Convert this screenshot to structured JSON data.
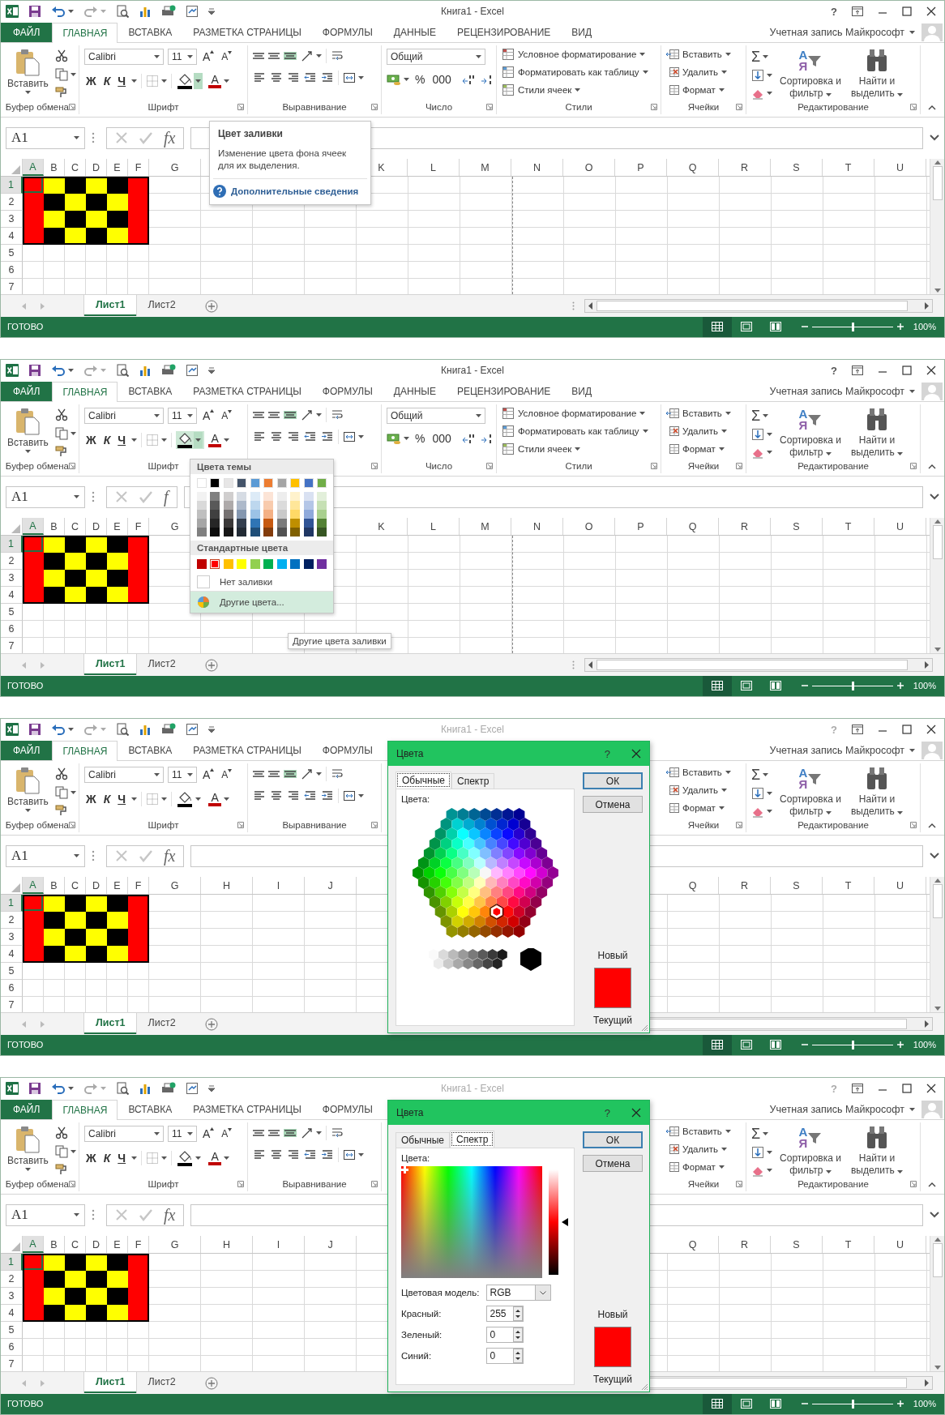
{
  "panels": [
    {
      "title_bar": {
        "title": "Книга1 - Excel",
        "active": true,
        "help": "?"
      },
      "ribbon_tabs": [
        {
          "label": "ФАЙЛ",
          "kind": "file",
          "selected": false
        },
        {
          "label": "ГЛАВНАЯ",
          "kind": "tab",
          "selected": true
        },
        {
          "label": "ВСТАВКА",
          "kind": "tab",
          "selected": false
        },
        {
          "label": "РАЗМЕТКА СТРАНИЦЫ",
          "kind": "tab",
          "selected": false
        },
        {
          "label": "ФОРМУЛЫ",
          "kind": "tab",
          "selected": false
        },
        {
          "label": "ДАННЫЕ",
          "kind": "tab",
          "selected": false
        },
        {
          "label": "РЕЦЕНЗИРОВАНИЕ",
          "kind": "tab",
          "selected": false
        },
        {
          "label": "ВИД",
          "kind": "tab",
          "selected": false
        }
      ],
      "account": "Учетная запись Майкрософт",
      "ribbon_groups": [
        {
          "kind": "clipboard",
          "label": "Буфер обмена",
          "paste": "Вставить"
        },
        {
          "kind": "font",
          "label": "Шрифт",
          "font": "Calibri",
          "size": "11",
          "grow": "A",
          "shrink": "A",
          "bold": "Ж",
          "italic": "К",
          "underline": "Ч",
          "font_color": "A",
          "fill_button_highlighted": false,
          "fill_caret_highlighted": true
        },
        {
          "kind": "alignment",
          "label": "Выравнивание",
          "bottom_align_on": true
        },
        {
          "kind": "number",
          "label": "Число",
          "format": "Общий",
          "percent": "%",
          "thousands": "000"
        },
        {
          "kind": "styles",
          "label": "Стили",
          "items": [
            "Условное форматирование",
            "Форматировать как таблицу",
            "Стили ячеек"
          ]
        },
        {
          "kind": "cells",
          "label": "Ячейки",
          "items": [
            "Вставить",
            "Удалить",
            "Формат"
          ]
        },
        {
          "kind": "editing",
          "label": "Редактирование",
          "autosum": "Σ",
          "sort_letters": [
            "A",
            "Я"
          ],
          "sort": "Сортировка и фильтр",
          "find": "Найти и выделить"
        }
      ],
      "formula_bar": {
        "name_box": "A1",
        "fx": "fx"
      },
      "grid": {
        "column_headers": [
          "A",
          "B",
          "C",
          "D",
          "E",
          "F",
          "G"
        ],
        "column_headers_right": [
          "K",
          "L",
          "M",
          "N",
          "O",
          "P",
          "Q",
          "R",
          "S",
          "T",
          "U"
        ],
        "rows": [
          {
            "header": "1",
            "cells": [
              {
                "color": "#ff0000",
                "selected": true
              },
              {
                "color": "#ffff00",
                "selected": false
              },
              {
                "color": "#000000",
                "selected": false
              },
              {
                "color": "#ffff00",
                "selected": false
              },
              {
                "color": "#000000",
                "selected": false
              },
              {
                "color": "#ff0000",
                "selected": false
              }
            ]
          },
          {
            "header": "2",
            "cells": [
              {
                "color": "#ff0000",
                "selected": false
              },
              {
                "color": "#000000",
                "selected": false
              },
              {
                "color": "#ffff00",
                "selected": false
              },
              {
                "color": "#000000",
                "selected": false
              },
              {
                "color": "#ffff00",
                "selected": false
              },
              {
                "color": "#ff0000",
                "selected": false
              }
            ]
          },
          {
            "header": "3",
            "cells": [
              {
                "color": "#ff0000",
                "selected": false
              },
              {
                "color": "#ffff00",
                "selected": false
              },
              {
                "color": "#000000",
                "selected": false
              },
              {
                "color": "#ffff00",
                "selected": false
              },
              {
                "color": "#000000",
                "selected": false
              },
              {
                "color": "#ff0000",
                "selected": false
              }
            ]
          },
          {
            "header": "4",
            "cells": [
              {
                "color": "#ff0000",
                "selected": false
              },
              {
                "color": "#000000",
                "selected": false
              },
              {
                "color": "#ffff00",
                "selected": false
              },
              {
                "color": "#000000",
                "selected": false
              },
              {
                "color": "#ffff00",
                "selected": false
              },
              {
                "color": "#ff0000",
                "selected": false
              }
            ]
          },
          {
            "header": "5"
          },
          {
            "header": "6"
          },
          {
            "header": "7"
          }
        ]
      },
      "sheet_tabs": [
        {
          "label": "Лист1",
          "selected": true
        },
        {
          "label": "Лист2",
          "selected": false
        }
      ],
      "status_bar": {
        "text": "ГОТОВО",
        "views": [
          {
            "kind": "normal",
            "selected": true
          },
          {
            "kind": "page_layout",
            "selected": false
          },
          {
            "kind": "page_break",
            "selected": false
          }
        ],
        "zoom_slider": {
          "level": 0.5
        },
        "zoom": "100%"
      },
      "tooltip": {
        "title": "Цвет заливки",
        "text": "Изменение цвета фона ячеек для их выделения.",
        "link": "Дополнительные сведения"
      }
    },
    {
      "title_bar": {
        "title": "Книга1 - Excel",
        "active": true,
        "help": "?"
      },
      "ribbon_tabs": [
        {
          "label": "ФАЙЛ",
          "kind": "file",
          "selected": false
        },
        {
          "label": "ГЛАВНАЯ",
          "kind": "tab",
          "selected": true
        },
        {
          "label": "ВСТАВКА",
          "kind": "tab",
          "selected": false
        },
        {
          "label": "РАЗМЕТКА СТРАНИЦЫ",
          "kind": "tab",
          "selected": false
        },
        {
          "label": "ФОРМУЛЫ",
          "kind": "tab",
          "selected": false
        },
        {
          "label": "ДАННЫЕ",
          "kind": "tab",
          "selected": false
        },
        {
          "label": "РЕЦЕНЗИРОВАНИЕ",
          "kind": "tab",
          "selected": false
        },
        {
          "label": "ВИД",
          "kind": "tab",
          "selected": false
        }
      ],
      "account": "Учетная запись Майкрософт",
      "ribbon_groups": [
        {
          "kind": "clipboard",
          "label": "Буфер обмена",
          "paste": "Вставить"
        },
        {
          "kind": "font",
          "label": "Шрифт",
          "font": "Calibri",
          "size": "11",
          "grow": "A",
          "shrink": "A",
          "bold": "Ж",
          "italic": "К",
          "underline": "Ч",
          "font_color": "A",
          "fill_button_highlighted": true,
          "fill_caret_highlighted": true
        },
        {
          "kind": "alignment",
          "bottom_align_on": true
        },
        {
          "kind": "number",
          "label": "Число",
          "format": "Общий",
          "percent": "%",
          "thousands": "000"
        },
        {
          "kind": "styles",
          "label": "Стили",
          "items": [
            "Условное форматирование",
            "Форматировать как таблицу",
            "Стили ячеек"
          ]
        },
        {
          "kind": "cells",
          "label": "Ячейки",
          "items": [
            "Вставить",
            "Удалить",
            "Формат"
          ]
        },
        {
          "kind": "editing",
          "label": "Редактирование",
          "autosum": "Σ",
          "sort_letters": [
            "A",
            "Я"
          ],
          "sort": "Сортировка и фильтр",
          "find": "Найти и выделить"
        }
      ],
      "formula_bar": {
        "name_box": "A1",
        "fx": "f"
      },
      "grid": {
        "column_headers": [
          "A",
          "B",
          "C",
          "D",
          "E",
          "F",
          "G"
        ],
        "column_headers_right": [
          "K",
          "L",
          "M",
          "N",
          "O",
          "P",
          "Q",
          "R",
          "S",
          "T",
          "U"
        ],
        "rows": [
          {
            "header": "1",
            "cells": [
              {
                "color": "#ff0000",
                "selected": true
              },
              {
                "color": "#ffff00",
                "selected": false
              },
              {
                "color": "#000000",
                "selected": false
              },
              {
                "color": "#ffff00",
                "selected": false
              },
              {
                "color": "#000000",
                "selected": false
              },
              {
                "color": "#ff0000",
                "selected": false
              }
            ]
          },
          {
            "header": "2",
            "cells": [
              {
                "color": "#ff0000",
                "selected": false
              },
              {
                "color": "#000000",
                "selected": false
              },
              {
                "color": "#ffff00",
                "selected": false
              },
              {
                "color": "#000000",
                "selected": false
              },
              {
                "color": "#ffff00",
                "selected": false
              },
              {
                "color": "#ff0000",
                "selected": false
              }
            ]
          },
          {
            "header": "3",
            "cells": [
              {
                "color": "#ff0000",
                "selected": false
              },
              {
                "color": "#ffff00",
                "selected": false
              },
              {
                "color": "#000000",
                "selected": false
              },
              {
                "color": "#ffff00",
                "selected": false
              },
              {
                "color": "#000000",
                "selected": false
              },
              {
                "color": "#ff0000",
                "selected": false
              }
            ]
          },
          {
            "header": "4",
            "cells": [
              {
                "color": "#ff0000",
                "selected": false
              },
              {
                "color": "#000000",
                "selected": false
              },
              {
                "color": "#ffff00",
                "selected": false
              },
              {
                "color": "#000000",
                "selected": false
              },
              {
                "color": "#ffff00",
                "selected": false
              },
              {
                "color": "#ff0000",
                "selected": false
              }
            ]
          },
          {
            "header": "5"
          },
          {
            "header": "6"
          },
          {
            "header": "7"
          }
        ]
      },
      "sheet_tabs": [
        {
          "label": "Лист1",
          "selected": true
        },
        {
          "label": "Лист2",
          "selected": false
        }
      ],
      "status_bar": {
        "text": "ГОТОВО",
        "views": [
          {
            "kind": "normal",
            "selected": true
          },
          {
            "kind": "page_layout",
            "selected": false
          },
          {
            "kind": "page_break",
            "selected": false
          }
        ],
        "zoom_slider": {
          "level": 0.5
        },
        "zoom": "100%"
      },
      "fill_menu": {
        "theme_header": "Цвета темы",
        "theme_colors": [
          {
            "color": "#ffffff",
            "shades": [
              {
                "color": "#f2f2f2"
              },
              {
                "color": "#d9d9d9"
              },
              {
                "color": "#bfbfbf"
              },
              {
                "color": "#a6a6a6"
              },
              {
                "color": "#808080"
              }
            ]
          },
          {
            "color": "#000000",
            "shades": [
              {
                "color": "#808080"
              },
              {
                "color": "#595959"
              },
              {
                "color": "#404040"
              },
              {
                "color": "#262626"
              },
              {
                "color": "#0d0d0d"
              }
            ]
          },
          {
            "color": "#e7e6e6",
            "shades": [
              {
                "color": "#d0cece"
              },
              {
                "color": "#aeaaaa"
              },
              {
                "color": "#757171"
              },
              {
                "color": "#3a3838"
              },
              {
                "color": "#161616"
              }
            ]
          },
          {
            "color": "#44546a",
            "shades": [
              {
                "color": "#d6dce4"
              },
              {
                "color": "#adb9ca"
              },
              {
                "color": "#8497b0"
              },
              {
                "color": "#333f4f"
              },
              {
                "color": "#222b35"
              }
            ]
          },
          {
            "color": "#5b9bd5",
            "shades": [
              {
                "color": "#ddebf7"
              },
              {
                "color": "#bdd7ee"
              },
              {
                "color": "#9bc2e6"
              },
              {
                "color": "#2f75b5"
              },
              {
                "color": "#1f4e78"
              }
            ]
          },
          {
            "color": "#ed7d31",
            "shades": [
              {
                "color": "#fce4d6"
              },
              {
                "color": "#f8cbad"
              },
              {
                "color": "#f4b084"
              },
              {
                "color": "#c65911"
              },
              {
                "color": "#833c0c"
              }
            ]
          },
          {
            "color": "#a5a5a5",
            "shades": [
              {
                "color": "#ededed"
              },
              {
                "color": "#dbdbdb"
              },
              {
                "color": "#c9c9c9"
              },
              {
                "color": "#7b7b7b"
              },
              {
                "color": "#525252"
              }
            ]
          },
          {
            "color": "#ffc000",
            "shades": [
              {
                "color": "#fff2cc"
              },
              {
                "color": "#ffe699"
              },
              {
                "color": "#ffd966"
              },
              {
                "color": "#bf8f00"
              },
              {
                "color": "#806000"
              }
            ]
          },
          {
            "color": "#4472c4",
            "shades": [
              {
                "color": "#d9e1f2"
              },
              {
                "color": "#b4c6e7"
              },
              {
                "color": "#8ea9db"
              },
              {
                "color": "#305496"
              },
              {
                "color": "#203764"
              }
            ]
          },
          {
            "color": "#70ad47",
            "shades": [
              {
                "color": "#e2efda"
              },
              {
                "color": "#c6e0b4"
              },
              {
                "color": "#a9d08e"
              },
              {
                "color": "#548235"
              },
              {
                "color": "#375623"
              }
            ]
          }
        ],
        "standard_header": "Стандартные цвета",
        "standard_colors": [
          {
            "color": "#c00000",
            "selected": false
          },
          {
            "color": "#ff0000",
            "selected": true
          },
          {
            "color": "#ffc000",
            "selected": false
          },
          {
            "color": "#ffff00",
            "selected": false
          },
          {
            "color": "#92d050",
            "selected": false
          },
          {
            "color": "#00b050",
            "selected": false
          },
          {
            "color": "#00b0f0",
            "selected": false
          },
          {
            "color": "#0070c0",
            "selected": false
          },
          {
            "color": "#002060",
            "selected": false
          },
          {
            "color": "#7030a0",
            "selected": false
          }
        ],
        "no_fill": "Нет заливки",
        "more": "Другие цвета...",
        "more_tooltip": "Другие цвета заливки"
      }
    },
    {
      "title_bar": {
        "title": "Книга1 - Excel",
        "active": false,
        "help": "?"
      },
      "ribbon_tabs": [
        {
          "label": "ФАЙЛ",
          "kind": "file",
          "selected": false
        },
        {
          "label": "ГЛАВНАЯ",
          "kind": "tab",
          "selected": true
        },
        {
          "label": "ВСТАВКА",
          "kind": "tab",
          "selected": false
        },
        {
          "label": "РАЗМЕТКА СТРАНИЦЫ",
          "kind": "tab",
          "selected": false
        },
        {
          "label": "ФОРМУЛЫ",
          "kind": "tab",
          "selected": false
        }
      ],
      "account": "Учетная запись Майкрософт",
      "ribbon_groups": [
        {
          "kind": "clipboard",
          "label": "Буфер обмена",
          "paste": "Вставить"
        },
        {
          "kind": "font",
          "label": "Шрифт",
          "font": "Calibri",
          "size": "11",
          "grow": "A",
          "shrink": "A",
          "bold": "Ж",
          "italic": "К",
          "underline": "Ч",
          "font_color": "A",
          "fill_button_highlighted": false,
          "fill_caret_highlighted": false
        },
        {
          "kind": "alignment",
          "label": "Выравнивание",
          "bottom_align_on": true
        },
        {
          "kind": "cells",
          "label": "Ячейки",
          "items": [
            "Вставить",
            "Удалить",
            "Формат"
          ]
        },
        {
          "kind": "editing",
          "label": "Редактирование",
          "autosum": "Σ",
          "sort_letters": [
            "A",
            "Я"
          ],
          "sort": "Сортировка и фильтр",
          "find": "Найти и выделить"
        }
      ],
      "formula_bar": {
        "name_box": "A1",
        "fx": "fx"
      },
      "grid": {
        "column_headers": [
          "A",
          "B",
          "C",
          "D",
          "E",
          "F",
          "G",
          "H",
          "I",
          "J"
        ],
        "column_headers_right": [
          "Q",
          "R",
          "S",
          "T",
          "U"
        ],
        "rows": [
          {
            "header": "1",
            "cells": [
              {
                "color": "#ff0000",
                "selected": true
              },
              {
                "color": "#ffff00",
                "selected": false
              },
              {
                "color": "#000000",
                "selected": false
              },
              {
                "color": "#ffff00",
                "selected": false
              },
              {
                "color": "#000000",
                "selected": false
              },
              {
                "color": "#ff0000",
                "selected": false
              }
            ]
          },
          {
            "header": "2",
            "cells": [
              {
                "color": "#ff0000",
                "selected": false
              },
              {
                "color": "#000000",
                "selected": false
              },
              {
                "color": "#ffff00",
                "selected": false
              },
              {
                "color": "#000000",
                "selected": false
              },
              {
                "color": "#ffff00",
                "selected": false
              },
              {
                "color": "#ff0000",
                "selected": false
              }
            ]
          },
          {
            "header": "3",
            "cells": [
              {
                "color": "#ff0000",
                "selected": false
              },
              {
                "color": "#ffff00",
                "selected": false
              },
              {
                "color": "#000000",
                "selected": false
              },
              {
                "color": "#ffff00",
                "selected": false
              },
              {
                "color": "#000000",
                "selected": false
              },
              {
                "color": "#ff0000",
                "selected": false
              }
            ]
          },
          {
            "header": "4",
            "cells": [
              {
                "color": "#ff0000",
                "selected": false
              },
              {
                "color": "#000000",
                "selected": false
              },
              {
                "color": "#ffff00",
                "selected": false
              },
              {
                "color": "#000000",
                "selected": false
              },
              {
                "color": "#ffff00",
                "selected": false
              },
              {
                "color": "#ff0000",
                "selected": false
              }
            ]
          },
          {
            "header": "5"
          },
          {
            "header": "6"
          },
          {
            "header": "7"
          }
        ]
      },
      "sheet_tabs": [
        {
          "label": "Лист1",
          "selected": true
        },
        {
          "label": "Лист2",
          "selected": false
        }
      ],
      "status_bar": {
        "text": "ГОТОВО",
        "views": [
          {
            "kind": "normal",
            "selected": true
          },
          {
            "kind": "page_layout",
            "selected": false
          },
          {
            "kind": "page_break",
            "selected": false
          }
        ],
        "zoom_slider": {
          "level": 0.5
        },
        "zoom": "100%"
      },
      "dialog": {
        "kind": "standard",
        "title": "Цвета",
        "help": "?",
        "tabs": [
          {
            "label": "Обычные",
            "selected": true
          },
          {
            "label": "Спектр",
            "selected": false
          }
        ],
        "colors_label": "Цвета:",
        "ok": "ОК",
        "cancel": "Отмена",
        "new_label": "Новый",
        "new_swatch": {
          "color": "#ff0000"
        },
        "current_swatch": {
          "color": "#ff0000"
        },
        "current_label": "Текущий"
      }
    },
    {
      "title_bar": {
        "title": "Книга1 - Excel",
        "active": false,
        "help": "?"
      },
      "ribbon_tabs": [
        {
          "label": "ФАЙЛ",
          "kind": "file",
          "selected": false
        },
        {
          "label": "ГЛАВНАЯ",
          "kind": "tab",
          "selected": true
        },
        {
          "label": "ВСТАВКА",
          "kind": "tab",
          "selected": false
        },
        {
          "label": "РАЗМЕТКА СТРАНИЦЫ",
          "kind": "tab",
          "selected": false
        },
        {
          "label": "ФОРМУЛЫ",
          "kind": "tab",
          "selected": false
        }
      ],
      "account": "Учетная запись Майкрософт",
      "ribbon_groups": [
        {
          "kind": "clipboard",
          "label": "Буфер обмена",
          "paste": "Вставить"
        },
        {
          "kind": "font",
          "label": "Шрифт",
          "font": "Calibri",
          "size": "11",
          "grow": "A",
          "shrink": "A",
          "bold": "Ж",
          "italic": "К",
          "underline": "Ч",
          "font_color": "A",
          "fill_button_highlighted": false,
          "fill_caret_highlighted": false
        },
        {
          "kind": "alignment",
          "label": "Выравнивание",
          "bottom_align_on": true
        },
        {
          "kind": "cells",
          "label": "Ячейки",
          "items": [
            "Вставить",
            "Удалить",
            "Формат"
          ]
        },
        {
          "kind": "editing",
          "label": "Редактирование",
          "autosum": "Σ",
          "sort_letters": [
            "A",
            "Я"
          ],
          "sort": "Сортировка и фильтр",
          "find": "Найти и выделить"
        }
      ],
      "formula_bar": {
        "name_box": "A1",
        "fx": "fx"
      },
      "grid": {
        "column_headers": [
          "A",
          "B",
          "C",
          "D",
          "E",
          "F",
          "G",
          "H",
          "I",
          "J"
        ],
        "column_headers_right": [
          "Q",
          "R",
          "S",
          "T",
          "U"
        ],
        "rows": [
          {
            "header": "1",
            "cells": [
              {
                "color": "#ff0000",
                "selected": true
              },
              {
                "color": "#ffff00",
                "selected": false
              },
              {
                "color": "#000000",
                "selected": false
              },
              {
                "color": "#ffff00",
                "selected": false
              },
              {
                "color": "#000000",
                "selected": false
              },
              {
                "color": "#ff0000",
                "selected": false
              }
            ]
          },
          {
            "header": "2",
            "cells": [
              {
                "color": "#ff0000",
                "selected": false
              },
              {
                "color": "#000000",
                "selected": false
              },
              {
                "color": "#ffff00",
                "selected": false
              },
              {
                "color": "#000000",
                "selected": false
              },
              {
                "color": "#ffff00",
                "selected": false
              },
              {
                "color": "#ff0000",
                "selected": false
              }
            ]
          },
          {
            "header": "3",
            "cells": [
              {
                "color": "#ff0000",
                "selected": false
              },
              {
                "color": "#ffff00",
                "selected": false
              },
              {
                "color": "#000000",
                "selected": false
              },
              {
                "color": "#ffff00",
                "selected": false
              },
              {
                "color": "#000000",
                "selected": false
              },
              {
                "color": "#ff0000",
                "selected": false
              }
            ]
          },
          {
            "header": "4",
            "cells": [
              {
                "color": "#ff0000",
                "selected": false
              },
              {
                "color": "#000000",
                "selected": false
              },
              {
                "color": "#ffff00",
                "selected": false
              },
              {
                "color": "#000000",
                "selected": false
              },
              {
                "color": "#ffff00",
                "selected": false
              },
              {
                "color": "#ff0000",
                "selected": false
              }
            ]
          },
          {
            "header": "5"
          },
          {
            "header": "6"
          },
          {
            "header": "7"
          }
        ]
      },
      "sheet_tabs": [
        {
          "label": "Лист1",
          "selected": true
        },
        {
          "label": "Лист2",
          "selected": false
        }
      ],
      "status_bar": {
        "text": "ГОТОВО",
        "views": [
          {
            "kind": "normal",
            "selected": true
          },
          {
            "kind": "page_layout",
            "selected": false
          },
          {
            "kind": "page_break",
            "selected": false
          }
        ],
        "zoom_slider": {
          "level": 0.5
        },
        "zoom": "100%"
      },
      "dialog": {
        "kind": "custom",
        "title": "Цвета",
        "help": "?",
        "tabs": [
          {
            "label": "Обычные",
            "selected": false
          },
          {
            "label": "Спектр",
            "selected": true
          }
        ],
        "colors_label": "Цвета:",
        "luminance": {
          "level": 0.5
        },
        "model_label": "Цветовая модель:",
        "model": "RGB",
        "channels": [
          {
            "label": "Красный:",
            "value": "255"
          },
          {
            "label": "Зеленый:",
            "value": "0"
          },
          {
            "label": "Синий:",
            "value": "0"
          }
        ],
        "ok": "ОК",
        "cancel": "Отмена",
        "new_label": "Новый",
        "new_swatch": {
          "color": "#ff0000"
        },
        "current_swatch": {
          "color": "#ff0000"
        },
        "current_label": "Текущий"
      }
    }
  ]
}
